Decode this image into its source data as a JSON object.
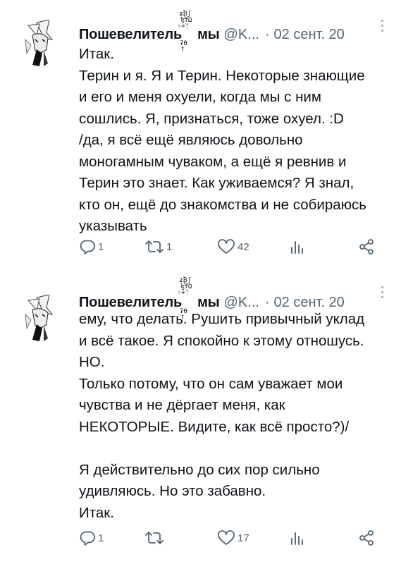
{
  "tweets": [
    {
      "display_name": "Пошевелитель",
      "display_name_tail": "мы",
      "handle": "@K...",
      "separator": "·",
      "time": "02 сент. 20",
      "lines": [
        "Итак.",
        "Терин и я. Я и Терин. Некоторые знающие",
        "и его и меня охуели, когда мы с ним",
        "сошлись. Я, признаться, тоже охуел. :D",
        "/да, я всё ещё являюсь довольно",
        "моногамным чуваком, а ещё я ревнив и",
        "Терин это знает. Как уживаемся? Я знал,",
        "кто он, ещё до знакомства и не собираюсь",
        "указывать"
      ],
      "actions": {
        "reply_count": "1",
        "retweet_count": "1",
        "like_count": "42",
        "reply_icon": "reply-icon",
        "retweet_icon": "retweet-icon",
        "like_icon": "heart-icon",
        "views_icon": "views-icon",
        "share_icon": "share-icon"
      }
    },
    {
      "display_name": "Пошевелитель",
      "display_name_tail": "мы",
      "handle": "@K...",
      "separator": "·",
      "time": "02 сент. 20",
      "lines": [
        "ему, что делать. Рушить привычный уклад",
        "и всё такое. Я спокойно к этому отношусь.",
        "НО.",
        "Только потому, что он сам уважает мои",
        "чувства и не дёргает меня, как",
        "НЕКОТОРЫЕ. Видите, как всё просто?)/",
        "",
        "Я действительно до сих пор сильно",
        "удивляюсь. Но это забавно.",
        "Итак."
      ],
      "actions": {
        "reply_count": "1",
        "retweet_count": "",
        "like_count": "17",
        "reply_icon": "reply-icon",
        "retweet_icon": "retweet-icon",
        "like_icon": "heart-icon",
        "views_icon": "views-icon",
        "share_icon": "share-icon"
      }
    }
  ],
  "colors": {
    "text": "#0f1419",
    "secondary": "#536471",
    "background": "#ffffff"
  }
}
